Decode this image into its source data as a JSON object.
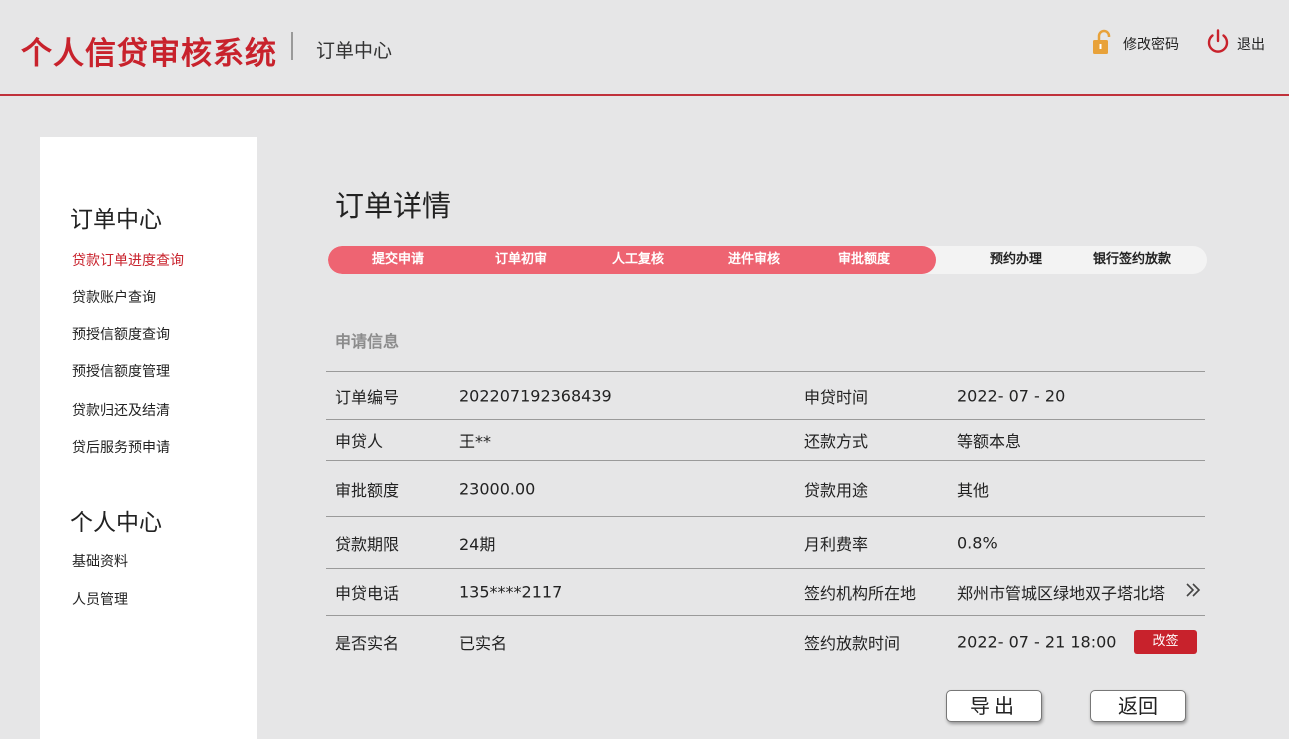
{
  "header": {
    "brand": "个人信贷审核系统",
    "subtitle": "订单中心",
    "change_password": "修改密码",
    "logout": "退出"
  },
  "sidebar": {
    "group1_title": "订单中心",
    "group1_items": [
      "贷款订单进度查询",
      "贷款账户查询",
      "预授信额度查询",
      "预授信额度管理",
      "贷款归还及结清",
      "贷后服务预申请"
    ],
    "group2_title": "个人中心",
    "group2_items": [
      "基础资料",
      "人员管理"
    ],
    "active_item": "贷款订单进度查询"
  },
  "page": {
    "title": "订单详情",
    "section_label": "申请信息"
  },
  "steps": {
    "items": [
      "提交申请",
      "订单初审",
      "人工复核",
      "进件审核",
      "审批额度",
      "预约办理",
      "银行签约放款"
    ],
    "completed_count": 5
  },
  "info": {
    "rows": [
      {
        "label1": "订单编号",
        "value1": "202207192368439",
        "label2": "申贷时间",
        "value2": "2022- 07 - 20"
      },
      {
        "label1": "申贷人",
        "value1": "王**",
        "label2": "还款方式",
        "value2": "等额本息"
      },
      {
        "label1": "审批额度",
        "value1": "23000.00",
        "label2": "贷款用途",
        "value2": "其他"
      },
      {
        "label1": "贷款期限",
        "value1": "24期",
        "label2": "月利费率",
        "value2": "0.8%"
      },
      {
        "label1": "申贷电话",
        "value1": "135****2117",
        "label2": "签约机构所在地",
        "value2": "郑州市管城区绿地双子塔北塔"
      },
      {
        "label1": "是否实名",
        "value1": "已实名",
        "label2": "签约放款时间",
        "value2": "2022- 07 - 21 18:00"
      }
    ],
    "change_button": "改签"
  },
  "buttons": {
    "export": "导出",
    "back": "返回"
  },
  "colors": {
    "brand_red": "#c8222c",
    "progress_pink": "#ee6472",
    "background": "#e6e6e7"
  },
  "icons": {
    "change_password": "unlock-icon",
    "logout": "power-icon",
    "more": "double-chevron-right-icon"
  }
}
